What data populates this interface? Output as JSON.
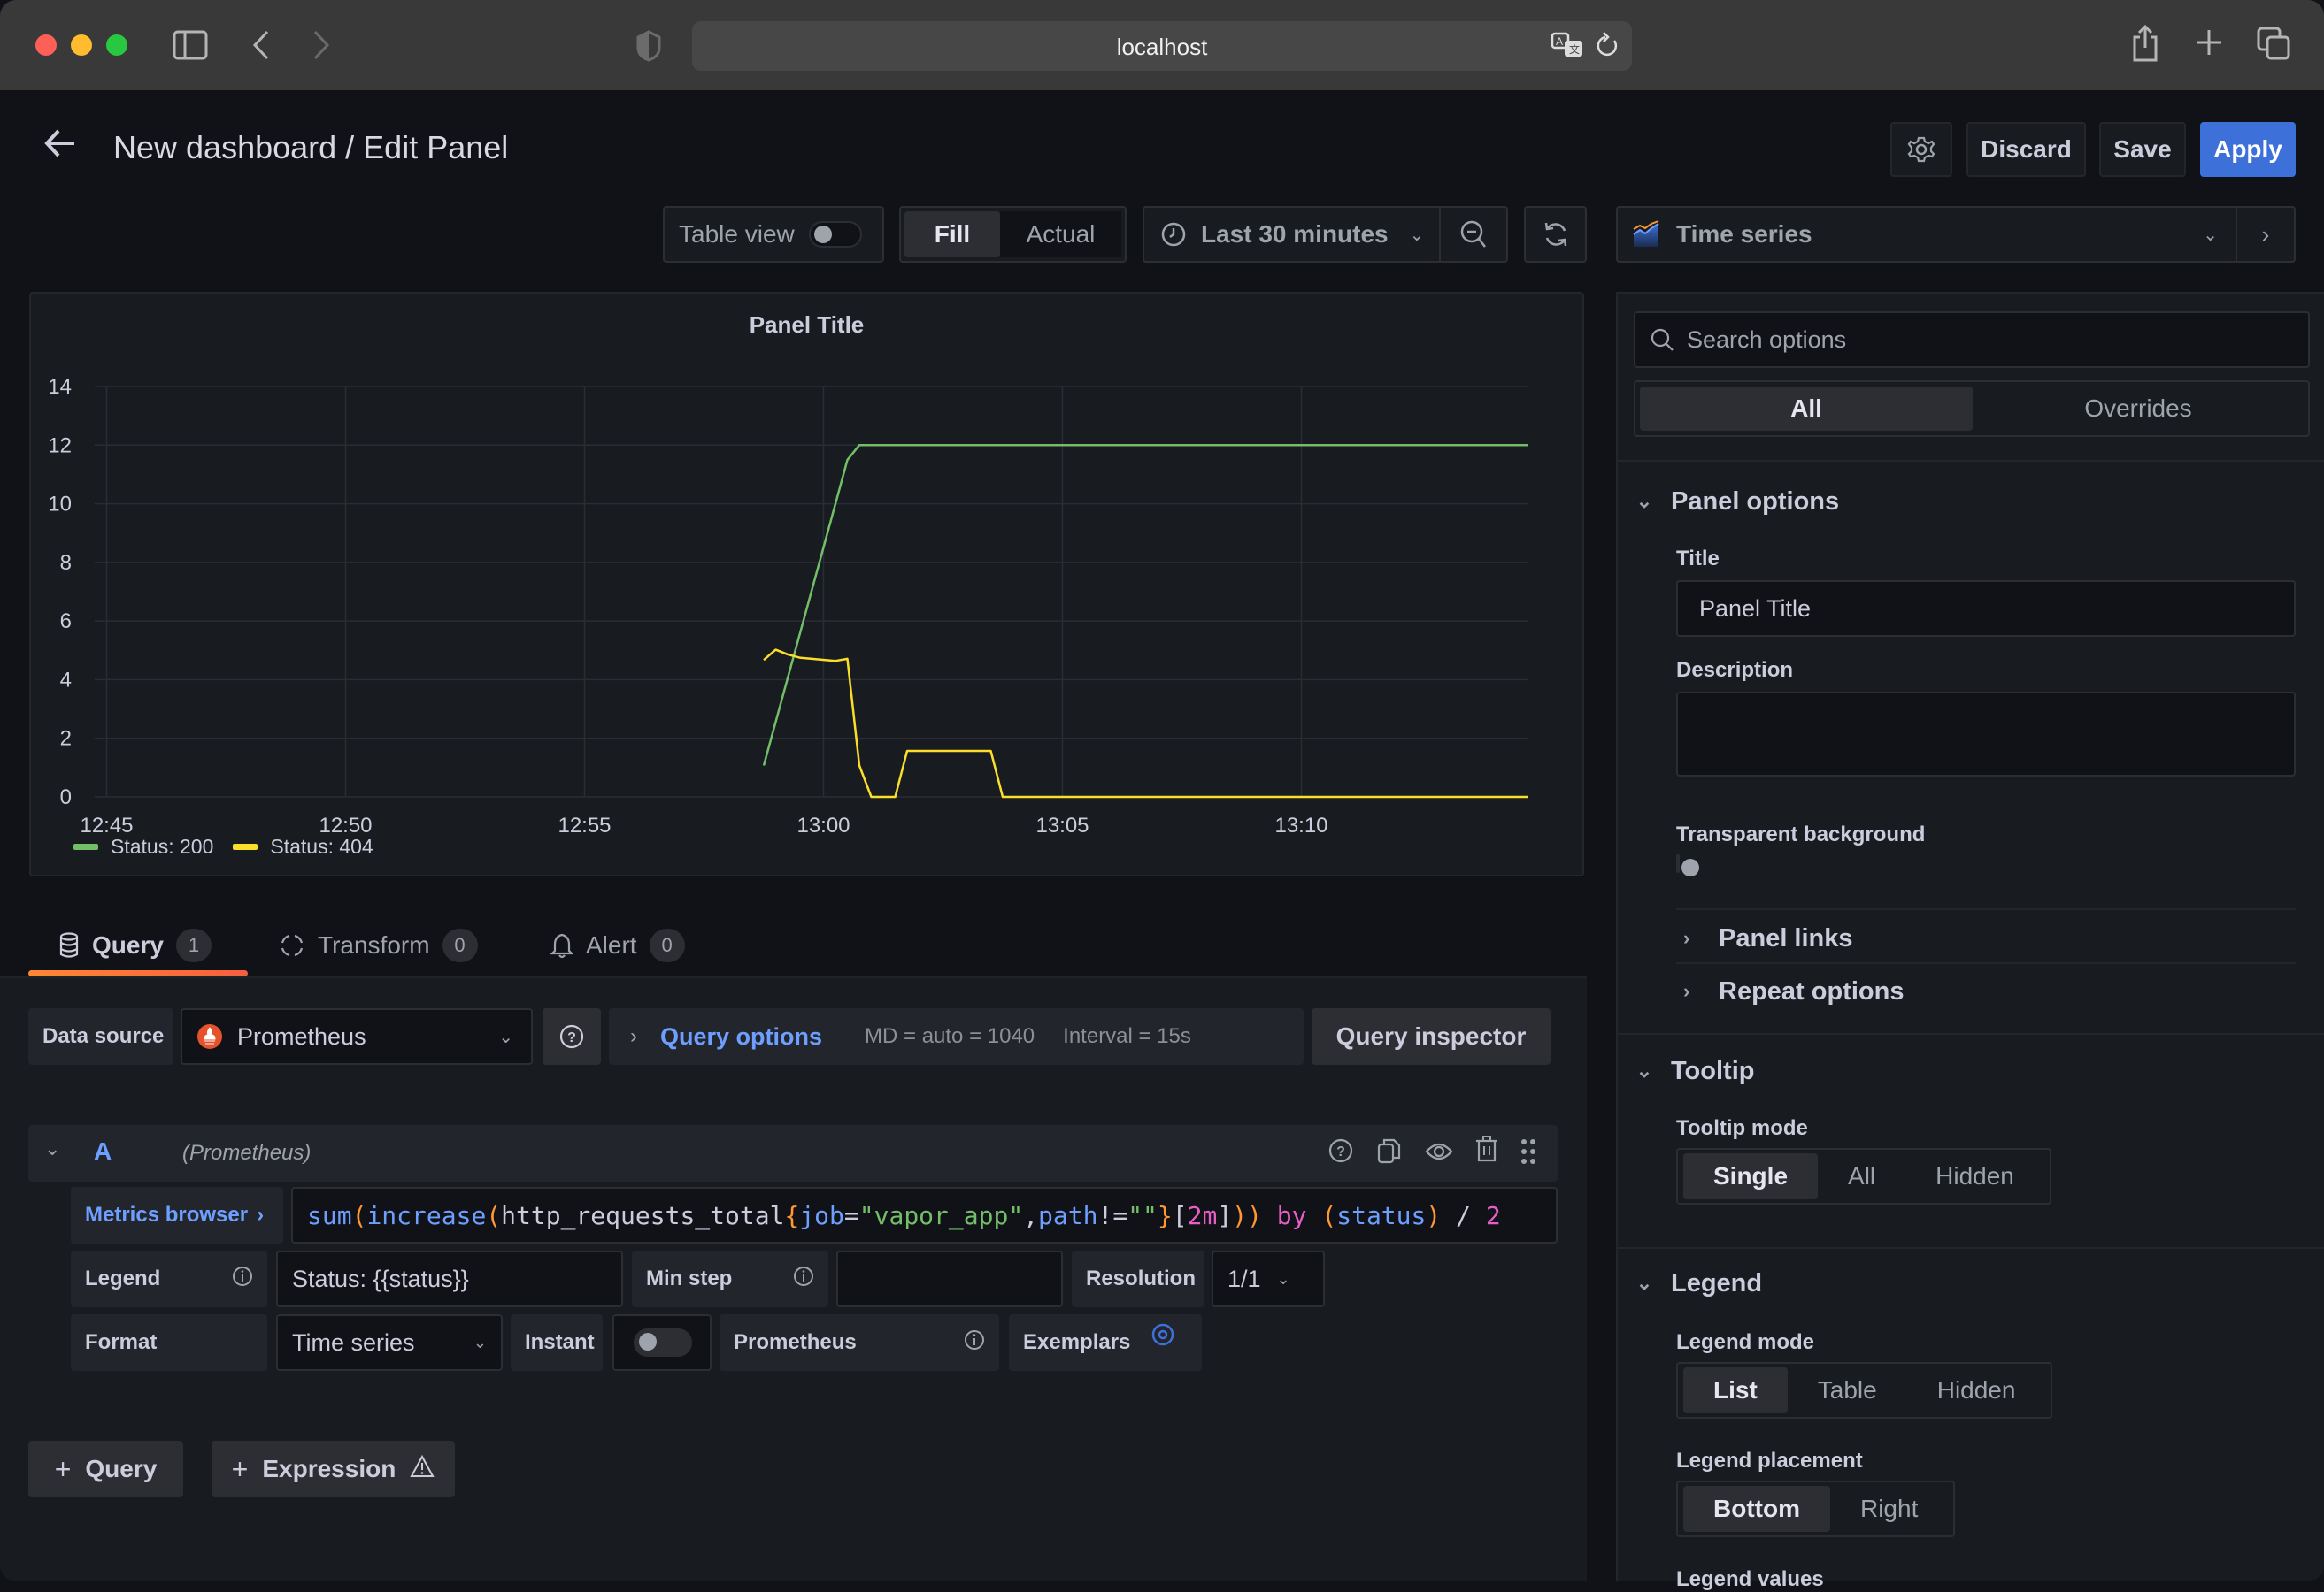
{
  "browser": {
    "url": "localhost",
    "traffic_lights": [
      "#fe5f57",
      "#febc2e",
      "#28c840"
    ]
  },
  "header": {
    "title": "New dashboard / Edit Panel",
    "discard_label": "Discard",
    "save_label": "Save",
    "apply_label": "Apply"
  },
  "toolbar": {
    "table_view_label": "Table view",
    "table_view_on": false,
    "fill_label": "Fill",
    "actual_label": "Actual",
    "fill_mode_selected": "Fill",
    "time_range": "Last 30 minutes",
    "visualization": "Time series"
  },
  "chart_data": {
    "type": "line",
    "title": "Panel Title",
    "xlabel": "",
    "ylabel": "",
    "x_ticks": [
      "12:45",
      "12:50",
      "12:55",
      "13:00",
      "13:05",
      "13:10"
    ],
    "x_range": [
      "12:44:45",
      "13:14:45"
    ],
    "y_ticks": [
      0,
      2,
      4,
      6,
      8,
      10,
      12,
      14
    ],
    "ylim": [
      0,
      14
    ],
    "grid": true,
    "legend_placement": "bottom-left",
    "series": [
      {
        "name": "Status: 200",
        "color": "#73bf69",
        "points": [
          [
            "12:58:45",
            1.07
          ],
          [
            "12:59:00",
            2.56
          ],
          [
            "12:59:15",
            4.05
          ],
          [
            "12:59:30",
            5.53
          ],
          [
            "12:59:45",
            7.02
          ],
          [
            "13:00:00",
            8.51
          ],
          [
            "13:00:15",
            10.0
          ],
          [
            "13:00:30",
            11.5
          ],
          [
            "13:00:45",
            12.0
          ],
          [
            "13:05:00",
            12.0
          ],
          [
            "13:10:00",
            12.0
          ],
          [
            "13:14:45",
            12.0
          ]
        ]
      },
      {
        "name": "Status: 404",
        "color": "#fade2a",
        "points": [
          [
            "12:58:45",
            4.67
          ],
          [
            "12:59:00",
            5.02
          ],
          [
            "12:59:15",
            4.86
          ],
          [
            "12:59:30",
            4.75
          ],
          [
            "13:00:15",
            4.64
          ],
          [
            "13:00:30",
            4.71
          ],
          [
            "13:00:45",
            1.07
          ],
          [
            "13:01:00",
            0
          ],
          [
            "13:01:30",
            0
          ],
          [
            "13:01:45",
            1.57
          ],
          [
            "13:03:30",
            1.57
          ],
          [
            "13:03:45",
            0
          ],
          [
            "13:14:45",
            0
          ]
        ]
      }
    ]
  },
  "tabs": [
    {
      "label": "Query",
      "count": "1",
      "active": true
    },
    {
      "label": "Transform",
      "count": "0",
      "active": false
    },
    {
      "label": "Alert",
      "count": "0",
      "active": false
    }
  ],
  "query_bar": {
    "data_source_label": "Data source",
    "data_source": "Prometheus",
    "query_options_label": "Query options",
    "md": "MD = auto = 1040",
    "interval": "Interval = 15s",
    "inspector_label": "Query inspector"
  },
  "query_a": {
    "ref_id": "A",
    "source_hint": "(Prometheus)",
    "metrics_browser_label": "Metrics browser",
    "expr_tokens": [
      {
        "t": "sum",
        "c": "fn"
      },
      {
        "t": "(",
        "c": "par"
      },
      {
        "t": "increase",
        "c": "fn"
      },
      {
        "t": "(",
        "c": "par"
      },
      {
        "t": "http_requests_total",
        "c": "met"
      },
      {
        "t": "{",
        "c": "par"
      },
      {
        "t": "job",
        "c": "lab"
      },
      {
        "t": "=",
        "c": "op"
      },
      {
        "t": "\"vapor_app\"",
        "c": "str"
      },
      {
        "t": ",",
        "c": "op"
      },
      {
        "t": "path",
        "c": "lab"
      },
      {
        "t": "!=",
        "c": "op"
      },
      {
        "t": "\"\"",
        "c": "str"
      },
      {
        "t": "}",
        "c": "par"
      },
      {
        "t": "[",
        "c": "op"
      },
      {
        "t": "2m",
        "c": "num"
      },
      {
        "t": "]",
        "c": "op"
      },
      {
        "t": "))",
        "c": "par"
      },
      {
        "t": " by ",
        "c": "kw"
      },
      {
        "t": "(",
        "c": "par"
      },
      {
        "t": "status",
        "c": "fn"
      },
      {
        "t": ")",
        "c": "par"
      },
      {
        "t": " / ",
        "c": "op"
      },
      {
        "t": "2",
        "c": "num"
      }
    ],
    "legend_label": "Legend",
    "legend_value": "Status: {{status}}",
    "min_step_label": "Min step",
    "min_step_value": "",
    "resolution_label": "Resolution",
    "resolution_value": "1/1",
    "format_label": "Format",
    "format_value": "Time series",
    "instant_label": "Instant",
    "instant_on": false,
    "prometheus_label": "Prometheus",
    "exemplars_label": "Exemplars"
  },
  "add_buttons": {
    "query_label": "Query",
    "expression_label": "Expression"
  },
  "options_pane": {
    "search_placeholder": "Search options",
    "all_label": "All",
    "overrides_label": "Overrides",
    "panel_options": {
      "heading": "Panel options",
      "title_label": "Title",
      "title_value": "Panel Title",
      "description_label": "Description",
      "description_value": "",
      "transparent_label": "Transparent background",
      "transparent_on": false,
      "panel_links_label": "Panel links",
      "repeat_options_label": "Repeat options"
    },
    "tooltip": {
      "heading": "Tooltip",
      "mode_label": "Tooltip mode",
      "options": [
        "Single",
        "All",
        "Hidden"
      ],
      "selected": "Single"
    },
    "legend": {
      "heading": "Legend",
      "mode_label": "Legend mode",
      "mode_options": [
        "List",
        "Table",
        "Hidden"
      ],
      "mode_selected": "List",
      "placement_label": "Legend placement",
      "placement_options": [
        "Bottom",
        "Right"
      ],
      "placement_selected": "Bottom",
      "values_label": "Legend values"
    }
  }
}
